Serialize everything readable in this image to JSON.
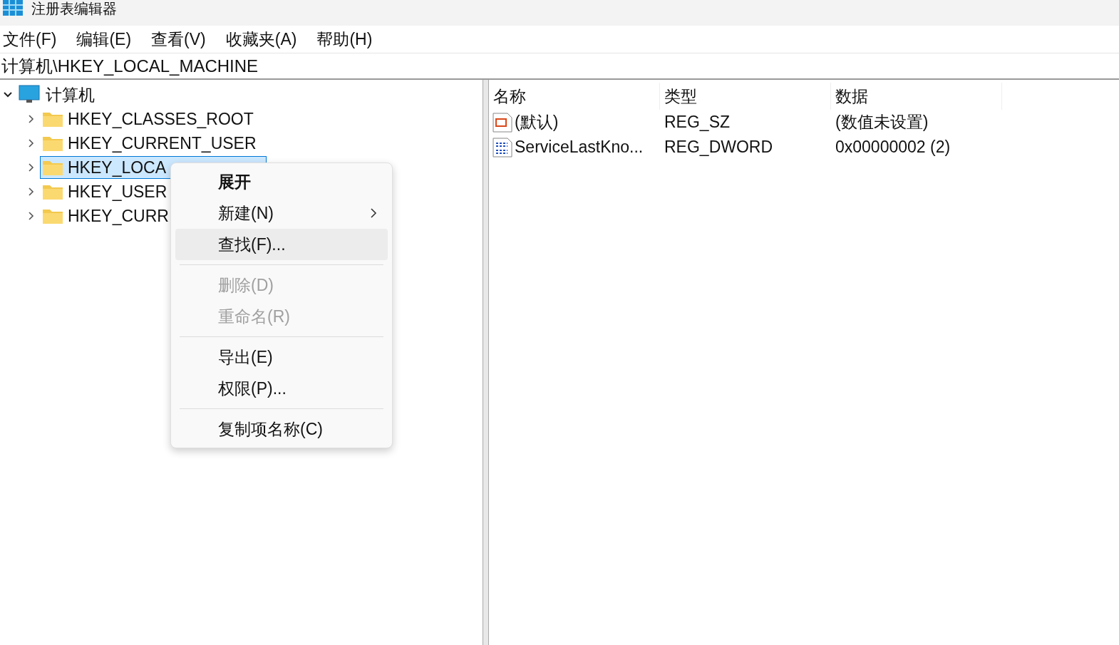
{
  "window": {
    "title": "注册表编辑器"
  },
  "menu_bar": [
    "文件(F)",
    "编辑(E)",
    "查看(V)",
    "收藏夹(A)",
    "帮助(H)"
  ],
  "address": "计算机\\HKEY_LOCAL_MACHINE",
  "tree": {
    "label": "计算机",
    "expanded": true,
    "children": [
      {
        "label": "HKEY_CLASSES_ROOT",
        "selected": false
      },
      {
        "label": "HKEY_CURRENT_USER",
        "selected": false
      },
      {
        "label": "HKEY_LOCA",
        "selected": true
      },
      {
        "label": "HKEY_USER",
        "selected": false
      },
      {
        "label": "HKEY_CURR",
        "selected": false
      }
    ]
  },
  "values": {
    "columns": [
      "名称",
      "类型",
      "数据"
    ],
    "rows": [
      {
        "kind": "string",
        "name": "(默认)",
        "type": "REG_SZ",
        "data": "(数值未设置)"
      },
      {
        "kind": "binary",
        "name": "ServiceLastKno...",
        "type": "REG_DWORD",
        "data": "0x00000002 (2)"
      }
    ]
  },
  "context_menu": [
    {
      "kind": "item",
      "label": "展开",
      "bold": true,
      "disabled": false,
      "highlighted": false,
      "submenu": false
    },
    {
      "kind": "item",
      "label": "新建(N)",
      "bold": false,
      "disabled": false,
      "highlighted": false,
      "submenu": true
    },
    {
      "kind": "item",
      "label": "查找(F)...",
      "bold": false,
      "disabled": false,
      "highlighted": true,
      "submenu": false
    },
    {
      "kind": "separator"
    },
    {
      "kind": "item",
      "label": "删除(D)",
      "bold": false,
      "disabled": true,
      "highlighted": false,
      "submenu": false
    },
    {
      "kind": "item",
      "label": "重命名(R)",
      "bold": false,
      "disabled": true,
      "highlighted": false,
      "submenu": false
    },
    {
      "kind": "separator"
    },
    {
      "kind": "item",
      "label": "导出(E)",
      "bold": false,
      "disabled": false,
      "highlighted": false,
      "submenu": false
    },
    {
      "kind": "item",
      "label": "权限(P)...",
      "bold": false,
      "disabled": false,
      "highlighted": false,
      "submenu": false
    },
    {
      "kind": "separator"
    },
    {
      "kind": "item",
      "label": "复制项名称(C)",
      "bold": false,
      "disabled": false,
      "highlighted": false,
      "submenu": false
    }
  ]
}
